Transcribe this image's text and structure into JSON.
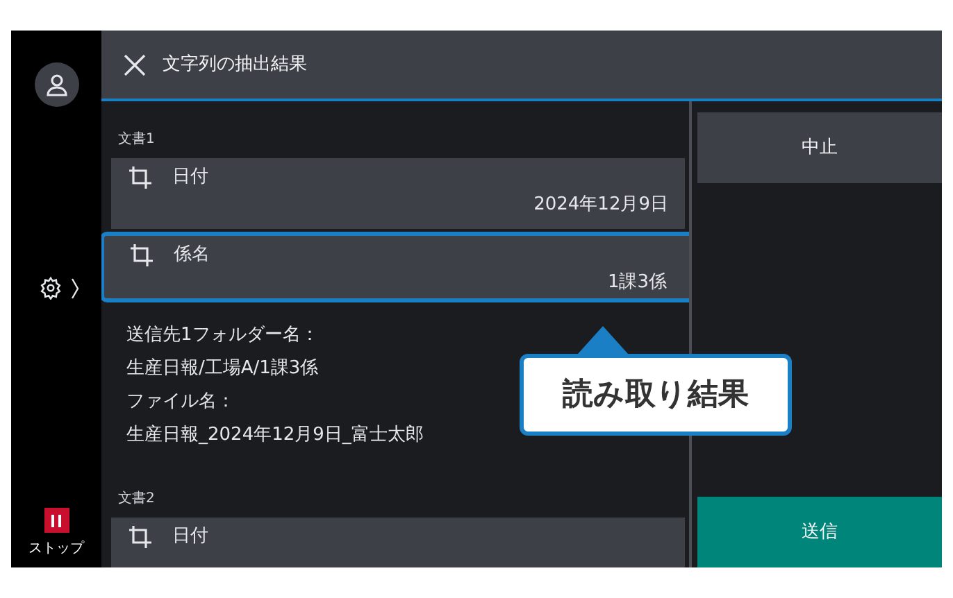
{
  "header": {
    "title": "文字列の抽出結果"
  },
  "sidebar": {
    "stop_label": "ストップ"
  },
  "documents": [
    {
      "label": "文書1",
      "rows": [
        {
          "name": "日付",
          "value": "2024年12月9日",
          "highlighted": false
        },
        {
          "name": "係名",
          "value": "1課3係",
          "highlighted": true
        }
      ],
      "details": [
        "送信先1フォルダー名：",
        "生産日報/工場A/1課3係",
        "ファイル名：",
        "生産日報_2024年12月9日_富士太郎"
      ]
    },
    {
      "label": "文書2",
      "rows": [
        {
          "name": "日付",
          "highlighted": false
        }
      ]
    }
  ],
  "actions": {
    "cancel": "中止",
    "send": "送信"
  },
  "callout": {
    "text": "読み取り結果"
  }
}
